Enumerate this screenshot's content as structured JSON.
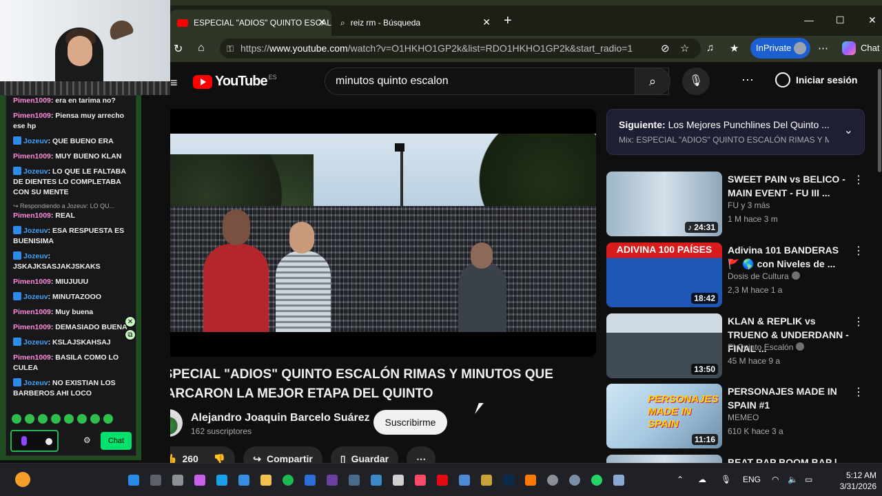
{
  "browser": {
    "tabs": [
      {
        "label": "ESPECIAL \"ADIOS\" QUINTO ESCAL",
        "active": true
      },
      {
        "label": "reiz rm - Búsqueda",
        "active": false
      }
    ],
    "url_prefix": "https://",
    "url_host": "www.youtube.com",
    "url_path": "/watch?v=O1HKHO1GP2k&list=RDO1HKHO1GP2k&start_radio=1",
    "inprivate": "InPrivate",
    "chat": "Chat"
  },
  "youtube": {
    "logo": "YouTube",
    "logo_country": "ES",
    "search_value": "minutos quinto escalon",
    "signin": "Iniciar sesión",
    "video_title": "ESPECIAL \"ADIOS\" QUINTO ESCALÓN RIMAS Y MINUTOS QUE MARCARON LA MEJOR ETAPA DEL QUINTO",
    "channel": "Alejandro Joaquin Barcelo Suárez",
    "subscribers": "162 suscriptores",
    "subscribe": "Suscribirme",
    "likes": "260",
    "share": "Compartir",
    "save": "Guardar",
    "next": {
      "label": "Siguiente:",
      "title": "Los Mejores Punchlines Del Quinto ...",
      "mix": "Mix: ESPECIAL \"ADIOS\" QUINTO ESCALÓN RIMAS Y MINU"
    },
    "recommendations": [
      {
        "title": "SWEET PAIN vs BELICO - MAIN EVENT - FU III ...",
        "channel": "FU y 3 más",
        "meta": "1 M   hace 3 m",
        "duration": "♪ 24:31"
      },
      {
        "title": "Adivina 101 BANDERAS 🚩 🌎 con Niveles de ...",
        "channel": "Dosis de Cultura",
        "meta": "2,3 M   hace 1 a",
        "duration": "18:42",
        "thumb_text": "ADIVINA 100 PAÍSES"
      },
      {
        "title": "KLAN & REPLIK vs TRUENO & UNDERDANN - FINAL ...",
        "channel": "El Quinto Escalón",
        "meta": "45 M   hace 9 a",
        "duration": "13:50"
      },
      {
        "title": "PERSONAJES MADE IN SPAIN #1",
        "channel": "MEMEO",
        "meta": "610 K   hace 3 a",
        "duration": "11:16",
        "thumb_text": "PERSONAJES MADE IN SPAIN"
      },
      {
        "title": "BEAT RAP BOOM BAP |"
      }
    ]
  },
  "chat_overlay": {
    "messages": [
      {
        "user": "Pimen1009",
        "color": "pink",
        "text": ": era en tarima no?"
      },
      {
        "user": "Pimen1009",
        "color": "pink",
        "text": ": Piensa muy arrecho ese hp"
      },
      {
        "user": "Jozeuv",
        "color": "blue",
        "badge": true,
        "text": ": QUE BUENO ERA"
      },
      {
        "user": "Pimen1009",
        "color": "pink",
        "text": ": MUY BUENO KLAN"
      },
      {
        "user": "Jozeuv",
        "color": "blue",
        "badge": true,
        "text": ": LO QUE LE FALTABA DE DIENTES LO COMPLETABA CON SU MENTE"
      },
      {
        "reply": "↪ Respondiendo a Jozeuv: LO QU...",
        "user": "Pimen1009",
        "color": "pink",
        "text": ": REAL"
      },
      {
        "user": "Jozeuv",
        "color": "blue",
        "badge": true,
        "text": ": ESA RESPUESTA ES BUENISIMA"
      },
      {
        "user": "Jozeuv",
        "color": "blue",
        "badge": true,
        "text": ": JSKAJKSASJAKJSKAKS"
      },
      {
        "user": "Pimen1009",
        "color": "pink",
        "text": ": MIUJUUU"
      },
      {
        "user": "Jozeuv",
        "color": "blue",
        "badge": true,
        "text": ": MINUTAZOOO"
      },
      {
        "user": "Pimen1009",
        "color": "pink",
        "text": ": Muy buena"
      },
      {
        "user": "Pimen1009",
        "color": "pink",
        "text": ": DEMASIADO BUENA"
      },
      {
        "user": "Jozeuv",
        "color": "blue",
        "badge": true,
        "text": ": KSLAJSKAHSAJ"
      },
      {
        "user": "Pimen1009",
        "color": "pink",
        "text": ": BASILA COMO LO CULEA"
      },
      {
        "user": "Jozeuv",
        "color": "blue",
        "badge": true,
        "text": ": NO EXISTIAN LOS BARBEROS AHI LOCO"
      }
    ],
    "chat_button": "Chat"
  },
  "taskbar": {
    "language": "ENG",
    "time": "5:12 AM",
    "date": "3/31/2026"
  }
}
